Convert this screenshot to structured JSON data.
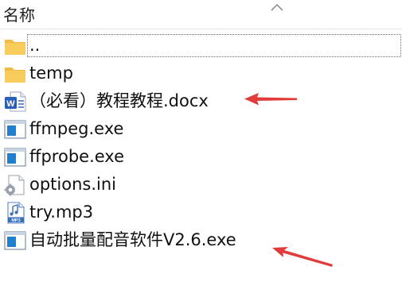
{
  "header": {
    "column_name": "名称"
  },
  "files": [
    {
      "name": "..",
      "icon": "folder-icon"
    },
    {
      "name": "temp",
      "icon": "folder-icon"
    },
    {
      "name": "（必看）教程教程.docx",
      "icon": "word-document-icon"
    },
    {
      "name": "ffmpeg.exe",
      "icon": "executable-icon"
    },
    {
      "name": "ffprobe.exe",
      "icon": "executable-icon"
    },
    {
      "name": "options.ini",
      "icon": "settings-file-icon"
    },
    {
      "name": "try.mp3",
      "icon": "mp3-file-icon"
    },
    {
      "name": "自动批量配音软件V2.6.exe",
      "icon": "executable-icon"
    }
  ],
  "colors": {
    "folder": "#f5c14a",
    "word_blue": "#2b5fb7",
    "exe_blue": "#1f7fd1",
    "annotation_red": "#e23b3b"
  }
}
